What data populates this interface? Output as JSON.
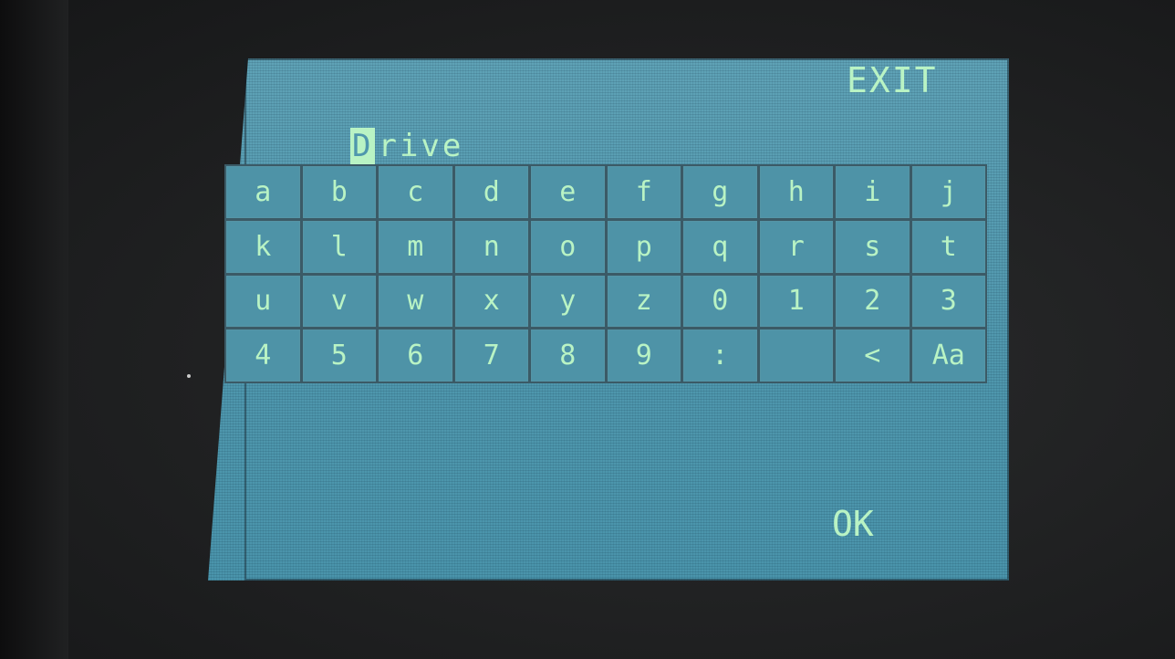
{
  "header": {
    "exit_label": "EXIT"
  },
  "name_field": {
    "cursor_char": "D",
    "rest": "rive"
  },
  "keyboard": {
    "rows": [
      [
        "a",
        "b",
        "c",
        "d",
        "e",
        "f",
        "g",
        "h",
        "i",
        "j"
      ],
      [
        "k",
        "l",
        "m",
        "n",
        "o",
        "p",
        "q",
        "r",
        "s",
        "t"
      ],
      [
        "u",
        "v",
        "w",
        "x",
        "y",
        "z",
        "0",
        "1",
        "2",
        "3"
      ],
      [
        "4",
        "5",
        "6",
        "7",
        "8",
        "9",
        ":",
        "",
        "<",
        "Aa"
      ]
    ]
  },
  "footer": {
    "ok_label": "OK"
  },
  "colors": {
    "screen": "#4f97ad",
    "text": "#b9f3c4",
    "grid": "#3b5a66"
  }
}
